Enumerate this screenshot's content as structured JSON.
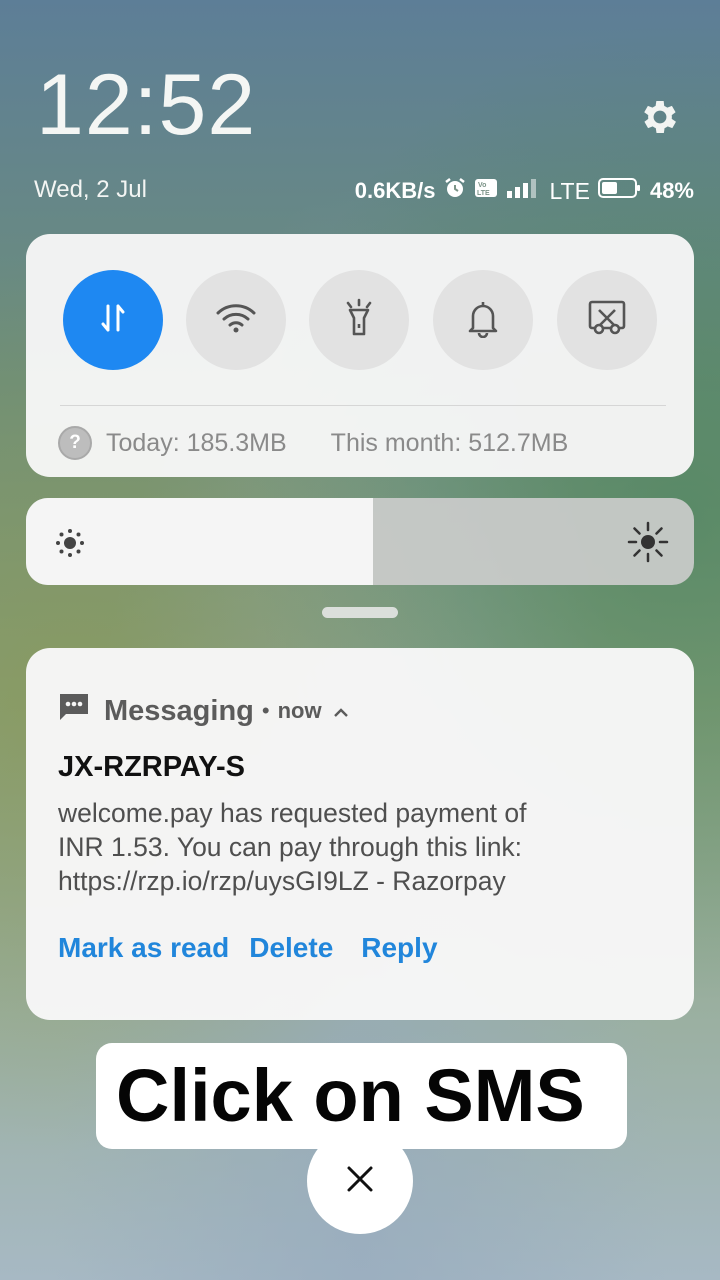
{
  "lockscreen": {
    "time": "12:52",
    "date": "Wed, 2 Jul",
    "settings_icon": "gear-icon"
  },
  "status_bar": {
    "speed": "0.6KB/s",
    "alarm_icon": "alarm-icon",
    "volte_icon": "volte-icon",
    "signal_icon": "signal-icon",
    "network": "LTE",
    "battery_icon": "battery-icon",
    "battery": "48%",
    "battery_level": 0.48
  },
  "quick_settings": {
    "tiles": [
      {
        "name": "mobile-data",
        "icon": "data-arrows-icon",
        "active": true
      },
      {
        "name": "wifi",
        "icon": "wifi-icon",
        "active": false
      },
      {
        "name": "flashlight",
        "icon": "flashlight-icon",
        "active": false
      },
      {
        "name": "sound",
        "icon": "bell-icon",
        "active": false
      },
      {
        "name": "screenshot",
        "icon": "screenshot-icon",
        "active": false
      }
    ],
    "usage_today": "Today: 185.3MB",
    "usage_month": "This month: 512.7MB",
    "accent_color": "#1e88f2"
  },
  "brightness": {
    "level": 0.52,
    "low_icon": "brightness-low-icon",
    "high_icon": "brightness-high-icon"
  },
  "notification": {
    "app_icon": "message-icon",
    "app": "Messaging",
    "separator": "•",
    "time": "now",
    "sender": "JX-RZRPAY-S",
    "body_lines": [
      "welcome.pay has requested payment of",
      "INR 1.53. You can pay through this link:",
      "https://rzp.io/rzp/uysGI9LZ - Razorpay"
    ],
    "actions": {
      "mark_read": "Mark as read",
      "delete": "Delete",
      "reply": "Reply"
    },
    "action_color": "#2186db"
  },
  "overlay": {
    "instruction": "Click on SMS",
    "close_icon": "close-icon"
  }
}
